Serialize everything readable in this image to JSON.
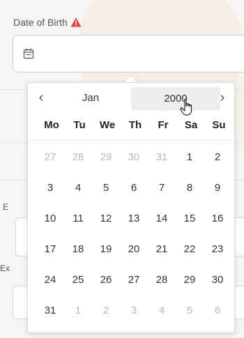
{
  "field": {
    "label": "Date of Birth",
    "value": ""
  },
  "background": {
    "label_e1": "E",
    "label_ex": "Ex"
  },
  "calendar": {
    "prev_label": "‹",
    "next_label": "›",
    "month": "Jan",
    "year": "2000",
    "weekdays": [
      "Mo",
      "Tu",
      "We",
      "Th",
      "Fr",
      "Sa",
      "Su"
    ],
    "weeks": [
      [
        {
          "d": "27",
          "m": true
        },
        {
          "d": "28",
          "m": true
        },
        {
          "d": "29",
          "m": true
        },
        {
          "d": "30",
          "m": true
        },
        {
          "d": "31",
          "m": true
        },
        {
          "d": "1",
          "m": false
        },
        {
          "d": "2",
          "m": false
        }
      ],
      [
        {
          "d": "3",
          "m": false
        },
        {
          "d": "4",
          "m": false
        },
        {
          "d": "5",
          "m": false
        },
        {
          "d": "6",
          "m": false
        },
        {
          "d": "7",
          "m": false
        },
        {
          "d": "8",
          "m": false
        },
        {
          "d": "9",
          "m": false
        }
      ],
      [
        {
          "d": "10",
          "m": false
        },
        {
          "d": "11",
          "m": false
        },
        {
          "d": "12",
          "m": false
        },
        {
          "d": "13",
          "m": false
        },
        {
          "d": "14",
          "m": false
        },
        {
          "d": "15",
          "m": false
        },
        {
          "d": "16",
          "m": false
        }
      ],
      [
        {
          "d": "17",
          "m": false
        },
        {
          "d": "18",
          "m": false
        },
        {
          "d": "19",
          "m": false
        },
        {
          "d": "20",
          "m": false
        },
        {
          "d": "21",
          "m": false
        },
        {
          "d": "22",
          "m": false
        },
        {
          "d": "23",
          "m": false
        }
      ],
      [
        {
          "d": "24",
          "m": false
        },
        {
          "d": "25",
          "m": false
        },
        {
          "d": "26",
          "m": false
        },
        {
          "d": "27",
          "m": false
        },
        {
          "d": "28",
          "m": false
        },
        {
          "d": "29",
          "m": false
        },
        {
          "d": "30",
          "m": false
        }
      ],
      [
        {
          "d": "31",
          "m": false
        },
        {
          "d": "1",
          "m": true
        },
        {
          "d": "2",
          "m": true
        },
        {
          "d": "3",
          "m": true
        },
        {
          "d": "4",
          "m": true
        },
        {
          "d": "5",
          "m": true
        },
        {
          "d": "6",
          "m": true
        }
      ]
    ]
  },
  "colors": {
    "warning": "#e8413b",
    "muted_day": "#b8b8bd",
    "year_highlight": "#eeeeee"
  },
  "icons": {
    "warning": "warning-triangle-icon",
    "calendar": "calendar-icon",
    "cursor": "hand-pointer-icon"
  }
}
